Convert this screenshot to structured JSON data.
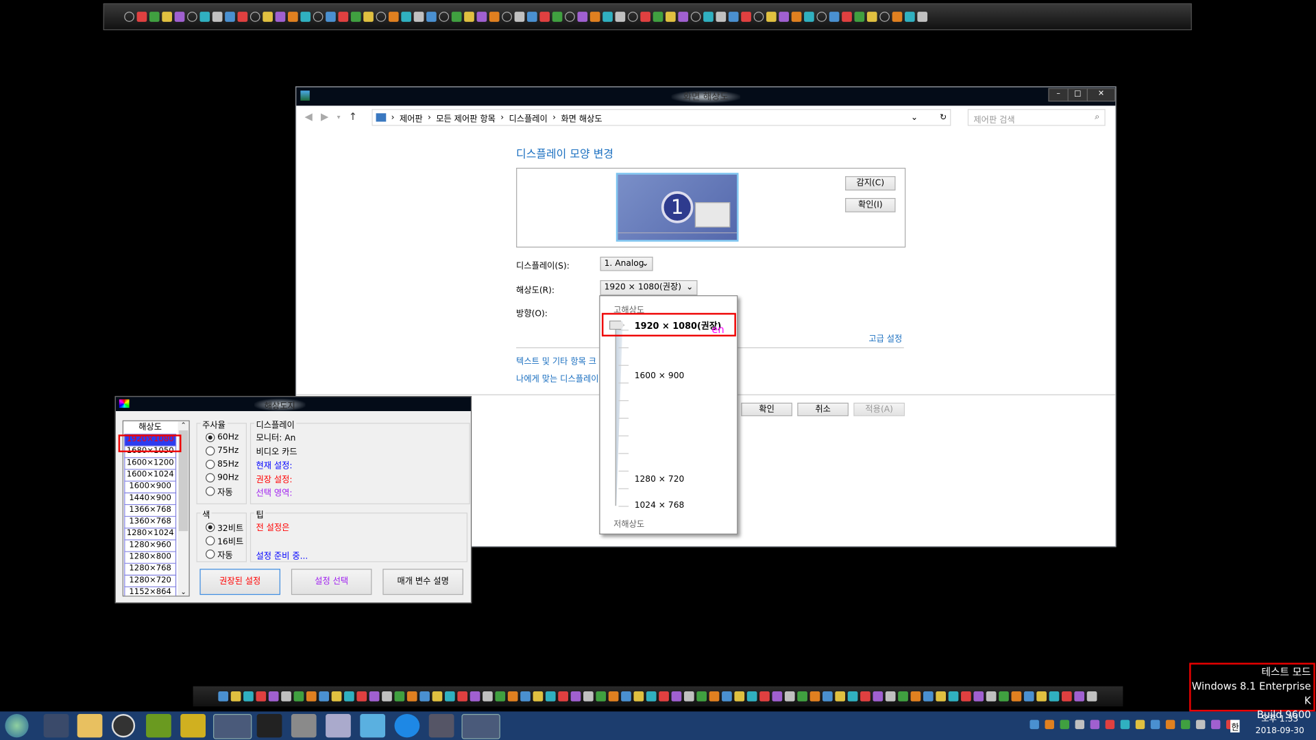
{
  "colors": {
    "accent": "#1a6fc0",
    "highlight_red": "#e00000",
    "taskbar": "#1c3d6e",
    "selected_blue": "#2c3cf0"
  },
  "top_toolbar": {
    "icon_count": 64
  },
  "main_window": {
    "title": "화면 해상도",
    "controls": {
      "minimize": "–",
      "maximize": "□",
      "close": "✕"
    },
    "breadcrumb": [
      "제어판",
      "모든 제어판 항목",
      "디스플레이",
      "화면 해상도"
    ],
    "search_placeholder": "제어판 검색",
    "heading": "디스플레이 모양 변경",
    "monitor_number": "1",
    "detect_button": "감지(C)",
    "identify_button": "확인(I)",
    "display_label": "디스플레이(S):",
    "display_value": "1. Analog",
    "resolution_label": "해상도(R):",
    "resolution_value": "1920 × 1080(권장)",
    "orientation_label": "방향(O):",
    "advanced_link": "고급 설정",
    "text_size_link": "텍스트 및 기타 항목 크",
    "which_display_link": "나에게 맞는 디스플레이",
    "ok_button": "확인",
    "cancel_button": "취소",
    "apply_button": "적용(A)"
  },
  "resolution_dropdown": {
    "high_label": "고해상도",
    "low_label": "저해상도",
    "selected": "1920 × 1080(권장)",
    "ime_indicator": "en",
    "labels": [
      "1600 × 900",
      "1280 × 720",
      "1024 × 768"
    ]
  },
  "res_tool": {
    "title": "해상도지",
    "list_header": "해상도",
    "resolutions": [
      "1920×1080",
      "1680×1050",
      "1600×1200",
      "1600×1024",
      "1600×900",
      "1440×900",
      "1366×768",
      "1360×768",
      "1280×1024",
      "1280×960",
      "1280×800",
      "1280×768",
      "1280×720",
      "1152×864",
      "1024×768"
    ],
    "selected_index": 0,
    "refresh_title": "주사율",
    "refresh_options": [
      "60Hz",
      "75Hz",
      "85Hz",
      "90Hz",
      "자동"
    ],
    "refresh_selected": 0,
    "color_title": "색",
    "color_options": [
      "32비트",
      "16비트",
      "자동"
    ],
    "color_selected": 0,
    "info_title": "디스플레이",
    "info_lines": [
      {
        "text": "모니터: An",
        "color": "#000000"
      },
      {
        "text": "비디오 카드",
        "color": "#000000"
      },
      {
        "text": "현재 설정:",
        "color": "#0000ff"
      },
      {
        "text": "권장 설정:",
        "color": "#ff0000"
      },
      {
        "text": "선택 영역:",
        "color": "#a020f0"
      }
    ],
    "tip_title": "팁",
    "tip_text": "전 설정은",
    "status_text": "설정 준비 중...",
    "buttons": [
      "권장된 설정",
      "설정 선택",
      "매개 변수 설명"
    ]
  },
  "watermark": {
    "line1": "테스트 모드",
    "line2": "Windows 8.1 Enterprise K",
    "line3": "Build 9600"
  },
  "clock": {
    "time": "오후 1:33",
    "date": "2018-09-30"
  },
  "tray": {
    "ime": "한",
    "lang": "en"
  }
}
